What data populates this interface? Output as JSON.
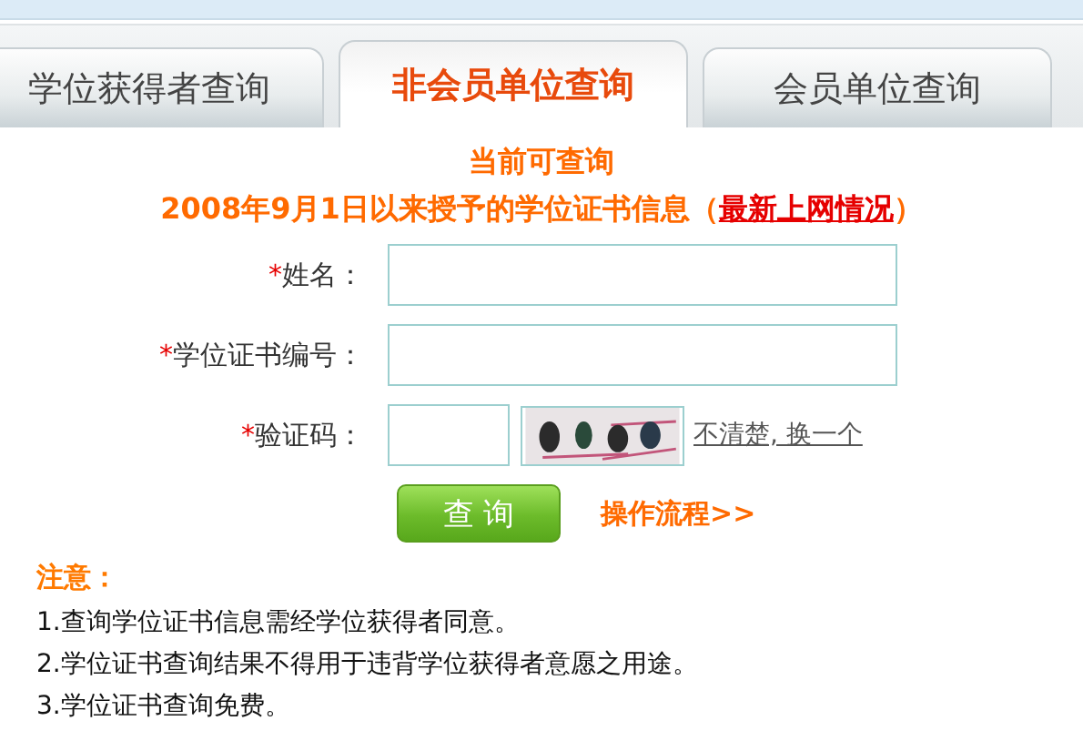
{
  "tabs": [
    {
      "label": "学位获得者查询",
      "selected": false
    },
    {
      "label": "非会员单位查询",
      "selected": true
    },
    {
      "label": "会员单位查询",
      "selected": false
    }
  ],
  "heading": {
    "title": "当前可查询",
    "subtitle": "2008年9月1日以来授予的学位证书信息（",
    "link": "最新上网情况",
    "subtitle_end": "）"
  },
  "form": {
    "fields": [
      {
        "label": "姓名：",
        "required_mark": "*",
        "kind": "text"
      },
      {
        "label": "学位证书编号：",
        "required_mark": "*",
        "kind": "text"
      },
      {
        "label": "验证码：",
        "required_mark": "*",
        "kind": "captcha",
        "refresh_link": "不清楚, 换一个"
      }
    ],
    "submit": "查 询",
    "process_link": "操作流程>>"
  },
  "notes": {
    "title": "注意：",
    "items": [
      "1.查询学位证书信息需经学位获得者同意。",
      "2.学位证书查询结果不得用于违背学位获得者意愿之用途。",
      "3.学位证书查询免费。"
    ]
  }
}
